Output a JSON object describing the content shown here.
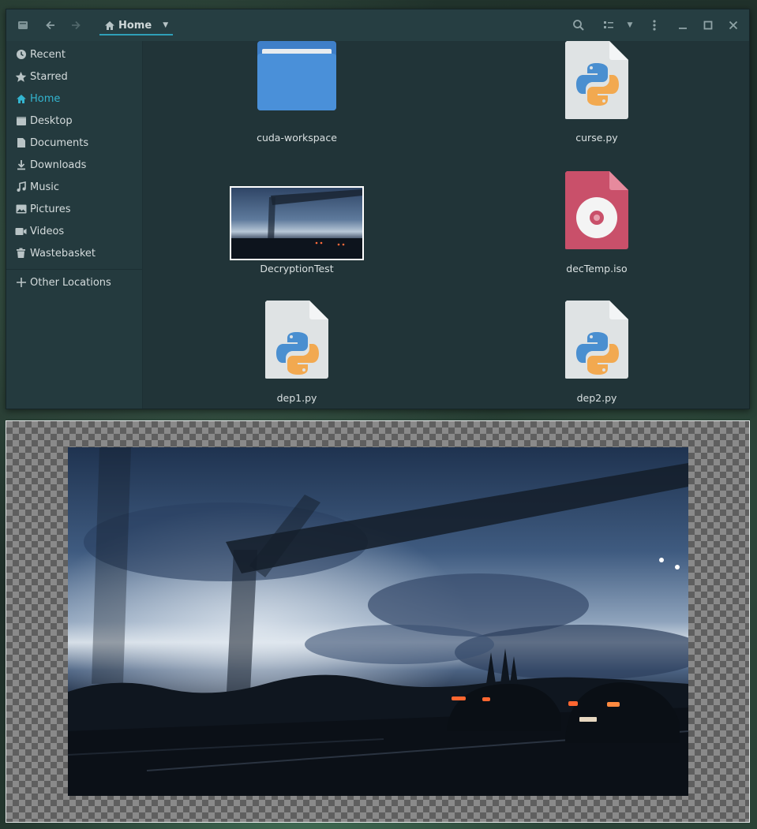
{
  "window": {
    "breadcrumb": "Home"
  },
  "sidebar": {
    "items": [
      {
        "label": "Recent",
        "icon": "clock-icon"
      },
      {
        "label": "Starred",
        "icon": "star-icon"
      },
      {
        "label": "Home",
        "icon": "home-icon"
      },
      {
        "label": "Desktop",
        "icon": "desktop-icon"
      },
      {
        "label": "Documents",
        "icon": "document-icon"
      },
      {
        "label": "Downloads",
        "icon": "download-icon"
      },
      {
        "label": "Music",
        "icon": "music-icon"
      },
      {
        "label": "Pictures",
        "icon": "picture-icon"
      },
      {
        "label": "Videos",
        "icon": "video-icon"
      },
      {
        "label": "Wastebasket",
        "icon": "trash-icon"
      }
    ],
    "other_locations": "Other Locations"
  },
  "files": [
    {
      "name": "cuda-workspace",
      "type": "folder"
    },
    {
      "name": "curse.py",
      "type": "python"
    },
    {
      "name": "DecryptionTest",
      "type": "image"
    },
    {
      "name": "decTemp.iso",
      "type": "disc-image"
    },
    {
      "name": "dep1.py",
      "type": "python"
    },
    {
      "name": "dep2.py",
      "type": "python"
    }
  ],
  "colors": {
    "accent": "#33b5d0",
    "folder": "#4a90d9",
    "iso": "#c9506a"
  }
}
